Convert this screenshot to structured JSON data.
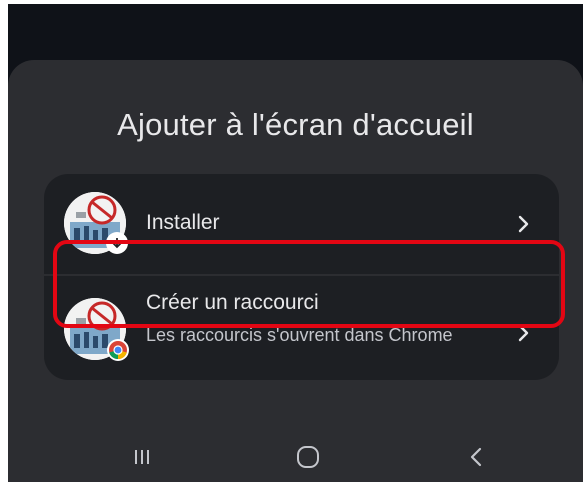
{
  "sheet": {
    "title": "Ajouter à l'écran d'accueil"
  },
  "options": [
    {
      "title": "Installer",
      "badge_icon": "download-arrow-icon",
      "chevron_icon": "chevron-right-icon"
    },
    {
      "title": "Créer un raccourci",
      "subtitle": "Les raccourcis s'ouvrent dans Chrome",
      "badge_icon": "chrome-icon",
      "chevron_icon": "chevron-right-icon"
    }
  ],
  "navbar": {
    "recents_icon": "recents-icon",
    "home_icon": "home-icon",
    "back_icon": "back-icon"
  },
  "colors": {
    "screen_background": "#0f1218",
    "sheet_background": "#2c2d31",
    "options_background": "#1d1f23",
    "text_primary": "#e8e8ea",
    "text_secondary": "#c4c6cc",
    "highlight_border": "#e30613"
  }
}
